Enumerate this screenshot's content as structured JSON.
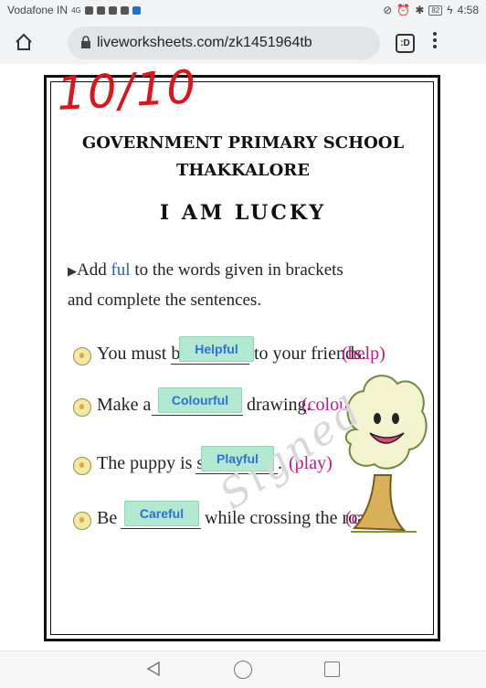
{
  "status": {
    "carrier": "Vodafone IN",
    "signal": "4G",
    "battery": "82",
    "time": "4:58"
  },
  "browser": {
    "url": "liveworksheets.com/zk1451964tb",
    "tabs_label": ":D"
  },
  "worksheet": {
    "score": "10/10",
    "school_line1": "GOVERNMENT PRIMARY SCHOOL",
    "school_line2": "THAKKALORE",
    "lesson_title": "I AM LUCKY",
    "instruction_part1": "Add ",
    "instruction_highlight": "ful",
    "instruction_part2": " to the words given in brackets and complete the sentences.",
    "items": [
      {
        "pre": "You must be",
        "answer": "Helpful",
        "post": "to your friends.",
        "word": "(help)"
      },
      {
        "pre": "Make a",
        "answer": "Colourful",
        "post": "drawing.",
        "word": "(colour)"
      },
      {
        "pre": "The puppy is so",
        "answer": "Playful",
        "post": ".",
        "word": "(play)"
      },
      {
        "pre": "Be",
        "answer": "Careful",
        "post": "while crossing the road.",
        "word": "(care)"
      }
    ],
    "watermark": "Signed"
  },
  "colors": {
    "score": "#e0131b",
    "answer_bg": "#b2ead1",
    "answer_text": "#2f6fd6",
    "bracket_word": "#c2188c"
  }
}
